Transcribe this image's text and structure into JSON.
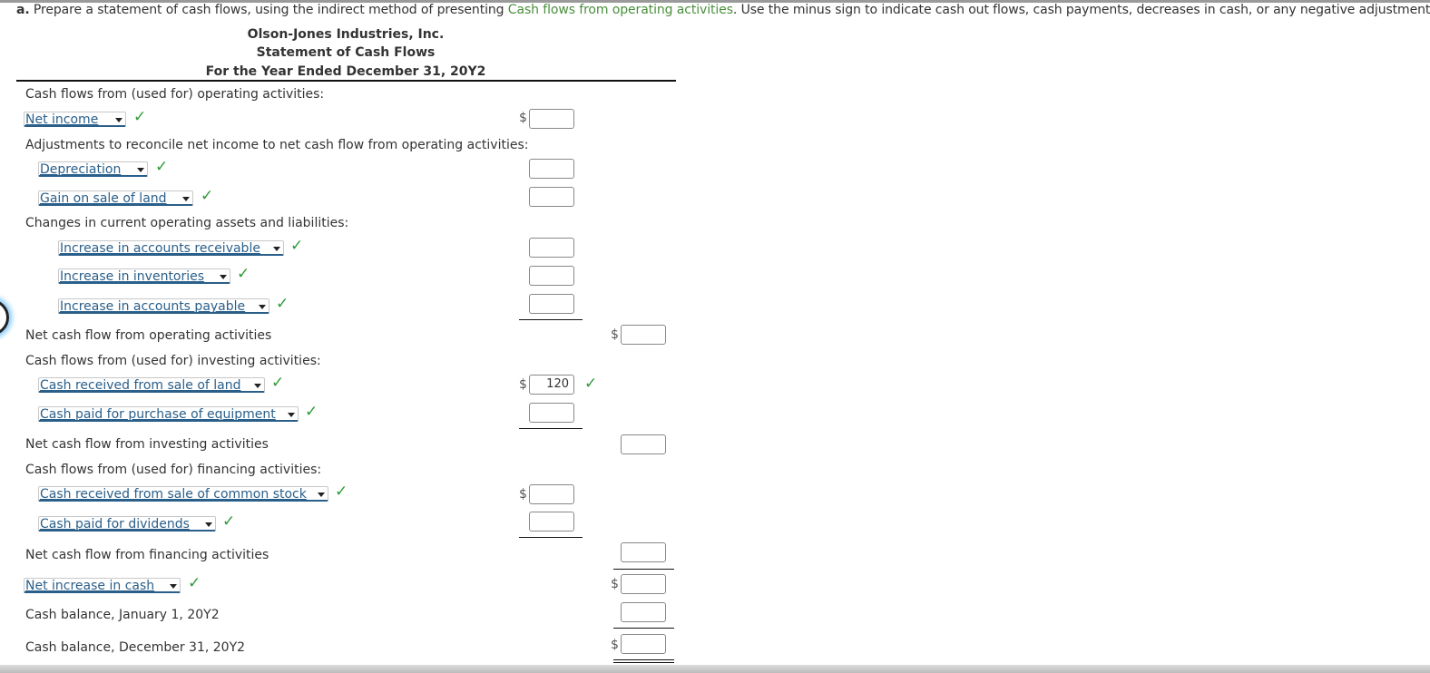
{
  "instruction": {
    "prefix": "a.",
    "text_before": " Prepare a statement of cash flows, using the indirect method of presenting ",
    "highlight": "Cash flows from operating activities",
    "text_after": ". Use the minus sign to indicate cash out flows, cash payments, decreases in cash, or any negative adjustments.",
    "highlight_color": "#4a8f3c"
  },
  "header": {
    "company": "Olson-Jones Industries, Inc.",
    "statement": "Statement of Cash Flows",
    "period": "For the Year Ended December 31, 20Y2"
  },
  "operating": {
    "section_label": "Cash flows from (used for) operating activities:",
    "net_income": {
      "selected": "Net income",
      "status": "correct",
      "value": ""
    },
    "adjustments_label": "Adjustments to reconcile net income to net cash flow from operating activities:",
    "adjustments": [
      {
        "selected": "Depreciation",
        "status": "correct",
        "value": ""
      },
      {
        "selected": "Gain on sale of land",
        "status": "correct",
        "value": ""
      }
    ],
    "changes_label": "Changes in current operating assets and liabilities:",
    "changes": [
      {
        "selected": "Increase in accounts receivable",
        "status": "correct",
        "value": ""
      },
      {
        "selected": "Increase in inventories",
        "status": "correct",
        "value": ""
      },
      {
        "selected": "Increase in accounts payable",
        "status": "correct",
        "value": ""
      }
    ],
    "net_label": "Net cash flow from operating activities",
    "net_value": ""
  },
  "investing": {
    "section_label": "Cash flows from (used for) investing activities:",
    "items": [
      {
        "selected": "Cash received from sale of land",
        "status": "correct",
        "value": "120",
        "value_status": "correct"
      },
      {
        "selected": "Cash paid for purchase of equipment",
        "status": "correct",
        "value": ""
      }
    ],
    "net_label": "Net cash flow from investing activities",
    "net_value": ""
  },
  "financing": {
    "section_label": "Cash flows from (used for) financing activities:",
    "items": [
      {
        "selected": "Cash received from sale of common stock",
        "status": "correct",
        "value": ""
      },
      {
        "selected": "Cash paid for dividends",
        "status": "correct",
        "value": ""
      }
    ],
    "net_label": "Net cash flow from financing activities",
    "net_value": ""
  },
  "summary": {
    "net_change": {
      "selected": "Net increase in cash",
      "status": "correct",
      "value": ""
    },
    "beginning_label": "Cash balance, January 1, 20Y2",
    "beginning_value": "",
    "ending_label": "Cash balance, December 31, 20Y2",
    "ending_value": ""
  },
  "symbols": {
    "dollar": "$",
    "check": "✓"
  }
}
